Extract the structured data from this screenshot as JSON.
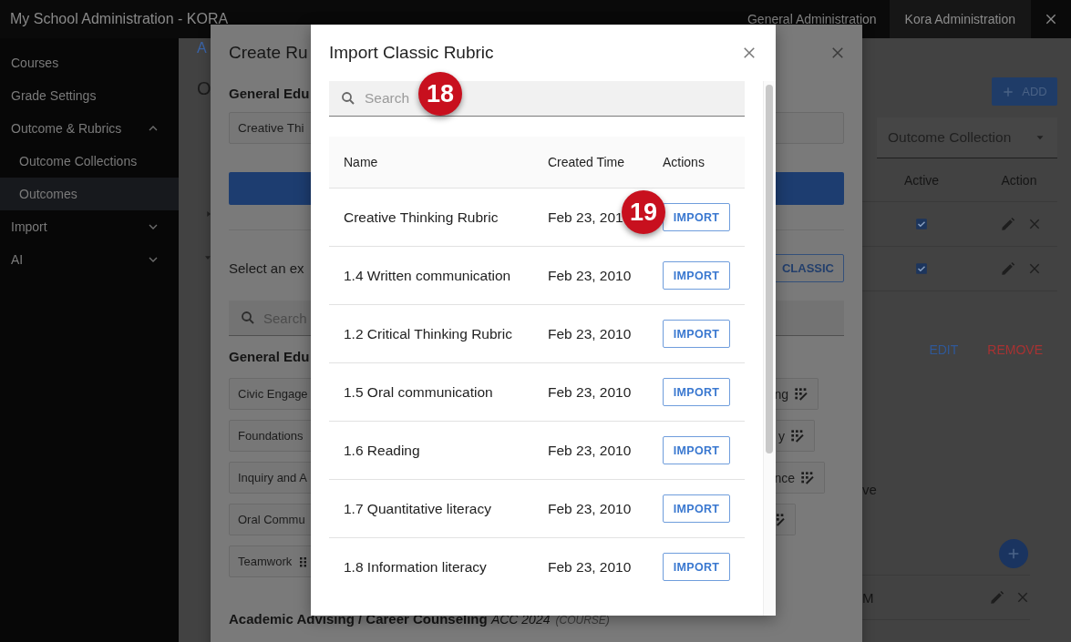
{
  "top_bar": {
    "title": "My School Administration - KORA",
    "tabs": [
      {
        "label": "General Administration",
        "selected": false
      },
      {
        "label": "Kora Administration",
        "selected": true
      }
    ]
  },
  "sidebar": {
    "items": [
      {
        "kind": "link",
        "label": "Courses",
        "selected": false
      },
      {
        "kind": "link",
        "label": "Grade Settings",
        "selected": false
      },
      {
        "kind": "group",
        "label": "Outcome & Rubrics",
        "expanded": true,
        "children": [
          {
            "kind": "link",
            "label": "Outcome Collections",
            "selected": false
          },
          {
            "kind": "link",
            "label": "Outcomes",
            "selected": true
          }
        ]
      },
      {
        "kind": "group",
        "label": "Import",
        "expanded": false
      },
      {
        "kind": "group",
        "label": "AI",
        "expanded": false
      }
    ]
  },
  "page": {
    "link": "A",
    "heading": "O",
    "tree_toggles": [
      {
        "expanded": false
      },
      {
        "expanded": true
      }
    ],
    "add_button": "ADD",
    "collection_select": {
      "value": "Outcome Collection"
    },
    "columns": [
      "Active",
      "Action"
    ],
    "rows": [
      {
        "active": true
      },
      {
        "active": true
      }
    ],
    "edit_button": "EDIT",
    "remove_button": "REMOVE",
    "text_fragment": "ve",
    "list_row": "M"
  },
  "create_rubric_dialog": {
    "title": "Create Ru",
    "section": "General Edu",
    "rubric_field": {
      "value": "Creative Thi"
    },
    "select_prompt": "Select an ex",
    "classic_button": "CLASSIC",
    "search": {
      "placeholder": "Search"
    },
    "group_title": "General Edu",
    "chips_left": [
      "Civic Engage",
      "Foundations",
      "Inquiry and A",
      "Oral Commu",
      "Teamwork"
    ],
    "chips_right": [
      {
        "kind": "text",
        "label": "ng"
      },
      {
        "kind": "text",
        "label": "y"
      },
      {
        "kind": "text",
        "label": "nce"
      },
      {
        "kind": "icon"
      }
    ],
    "next_group": "**Academic Advising / Career Counseling** *ACC 2024*",
    "next_group_tag": "(COURSE)"
  },
  "import_dialog": {
    "title": "Import Classic Rubric",
    "search": {
      "placeholder": "Search"
    },
    "columns": [
      "Name",
      "Created Time",
      "Actions"
    ],
    "rows": [
      {
        "name": "Creative Thinking Rubric",
        "created": "Feb 23, 201",
        "action": "IMPORT"
      },
      {
        "name": "1.4 Written communication",
        "created": "Feb 23, 2010",
        "action": "IMPORT"
      },
      {
        "name": "1.2 Critical Thinking Rubric",
        "created": "Feb 23, 2010",
        "action": "IMPORT"
      },
      {
        "name": "1.5 Oral communication",
        "created": "Feb 23, 2010",
        "action": "IMPORT"
      },
      {
        "name": "1.6 Reading",
        "created": "Feb 23, 2010",
        "action": "IMPORT"
      },
      {
        "name": "1.7 Quantitative literacy",
        "created": "Feb 23, 2010",
        "action": "IMPORT"
      },
      {
        "name": "1.8 Information literacy",
        "created": "Feb 23, 2010",
        "action": "IMPORT"
      }
    ]
  },
  "annotations": [
    {
      "number": "18"
    },
    {
      "number": "19"
    }
  ]
}
